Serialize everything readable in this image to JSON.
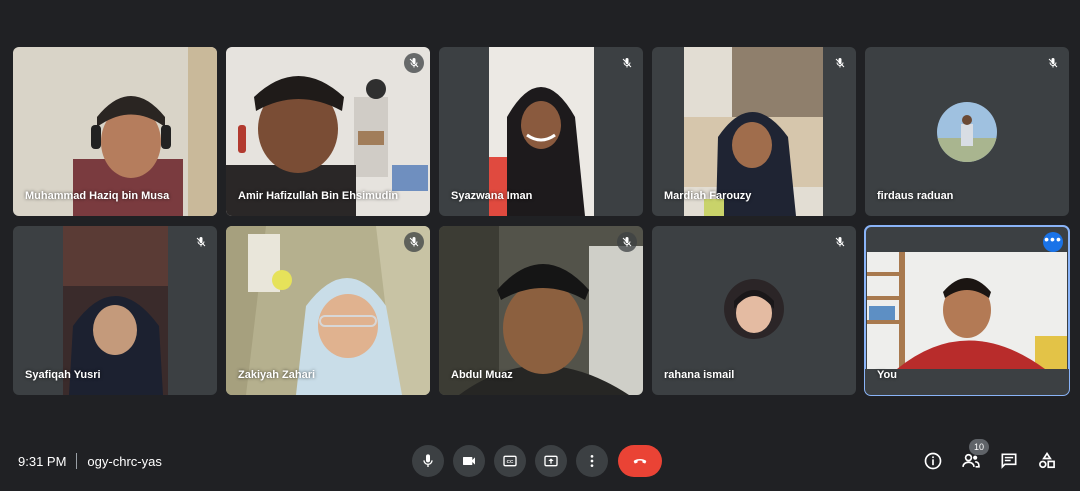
{
  "meeting": {
    "time": "9:31 PM",
    "code": "ogy-chrc-yas"
  },
  "participants": [
    {
      "name": "Muhammad Haziq bin Musa",
      "muted": false
    },
    {
      "name": "Amir Hafizullah Bin Ehsimudin",
      "muted": true
    },
    {
      "name": "Syazwana Iman",
      "muted": true
    },
    {
      "name": "Mardiah Farouzy",
      "muted": true
    },
    {
      "name": "firdaus raduan",
      "muted": true
    },
    {
      "name": "Syafiqah Yusri",
      "muted": true
    },
    {
      "name": "Zakiyah Zahari",
      "muted": true
    },
    {
      "name": "Abdul Muaz",
      "muted": true
    },
    {
      "name": "rahana ismail",
      "muted": true
    },
    {
      "name": "You",
      "muted": false,
      "selected": true
    }
  ],
  "toolbar": {
    "more_label": "•••",
    "people_count": "10"
  },
  "icons": {
    "microphone": "microphone-icon",
    "camera": "camera-icon",
    "captions": "captions-icon",
    "present": "present-screen-icon",
    "more": "more-options-icon",
    "end_call": "end-call-icon",
    "info": "info-icon",
    "people": "people-icon",
    "chat": "chat-icon",
    "activities": "activities-icon"
  },
  "colors": {
    "background": "#202124",
    "tile": "#3c4043",
    "end_call": "#ea4335",
    "selected_outline": "#8ab4f8",
    "accent": "#1a73e8"
  }
}
